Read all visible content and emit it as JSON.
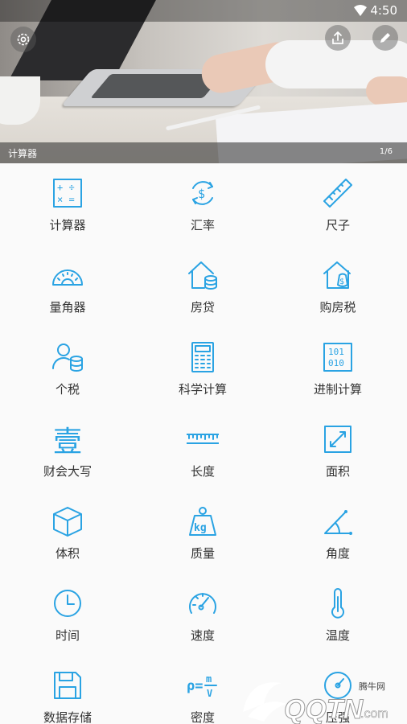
{
  "status_bar": {
    "time": "4:50"
  },
  "banner": {
    "title": "计算器",
    "page": "1/6"
  },
  "tools": [
    {
      "label": "计算器",
      "icon": "calculator-icon"
    },
    {
      "label": "汇率",
      "icon": "exchange-rate-icon"
    },
    {
      "label": "尺子",
      "icon": "ruler-icon"
    },
    {
      "label": "量角器",
      "icon": "protractor-icon"
    },
    {
      "label": "房贷",
      "icon": "mortgage-icon"
    },
    {
      "label": "购房税",
      "icon": "house-tax-icon"
    },
    {
      "label": "个税",
      "icon": "income-tax-icon"
    },
    {
      "label": "科学计算",
      "icon": "scientific-calculator-icon"
    },
    {
      "label": "进制计算",
      "icon": "binary-icon"
    },
    {
      "label": "财会大写",
      "icon": "chinese-numeral-icon"
    },
    {
      "label": "长度",
      "icon": "length-icon"
    },
    {
      "label": "面积",
      "icon": "area-icon"
    },
    {
      "label": "体积",
      "icon": "volume-icon"
    },
    {
      "label": "质量",
      "icon": "weight-icon"
    },
    {
      "label": "角度",
      "icon": "angle-icon"
    },
    {
      "label": "时间",
      "icon": "clock-icon"
    },
    {
      "label": "速度",
      "icon": "speedometer-icon"
    },
    {
      "label": "温度",
      "icon": "thermometer-icon"
    },
    {
      "label": "数据存储",
      "icon": "floppy-disk-icon"
    },
    {
      "label": "密度",
      "icon": "density-icon"
    },
    {
      "label": "压强",
      "icon": "pressure-gauge-icon"
    }
  ],
  "icon_text": {
    "plus_minus": "+ ÷",
    "times_eq": "× =",
    "dollar": "$",
    "binary_top": "101",
    "binary_bottom": "010",
    "kg": "kg",
    "numeral": "壹",
    "density_rho": "ρ=",
    "density_m": "m",
    "density_v": "V"
  },
  "watermark": {
    "site": "腾牛网",
    "brand": "QQTN",
    "tld": ".com"
  },
  "colors": {
    "accent": "#2aa3e3",
    "label": "#333333",
    "background": "#fafafa"
  }
}
